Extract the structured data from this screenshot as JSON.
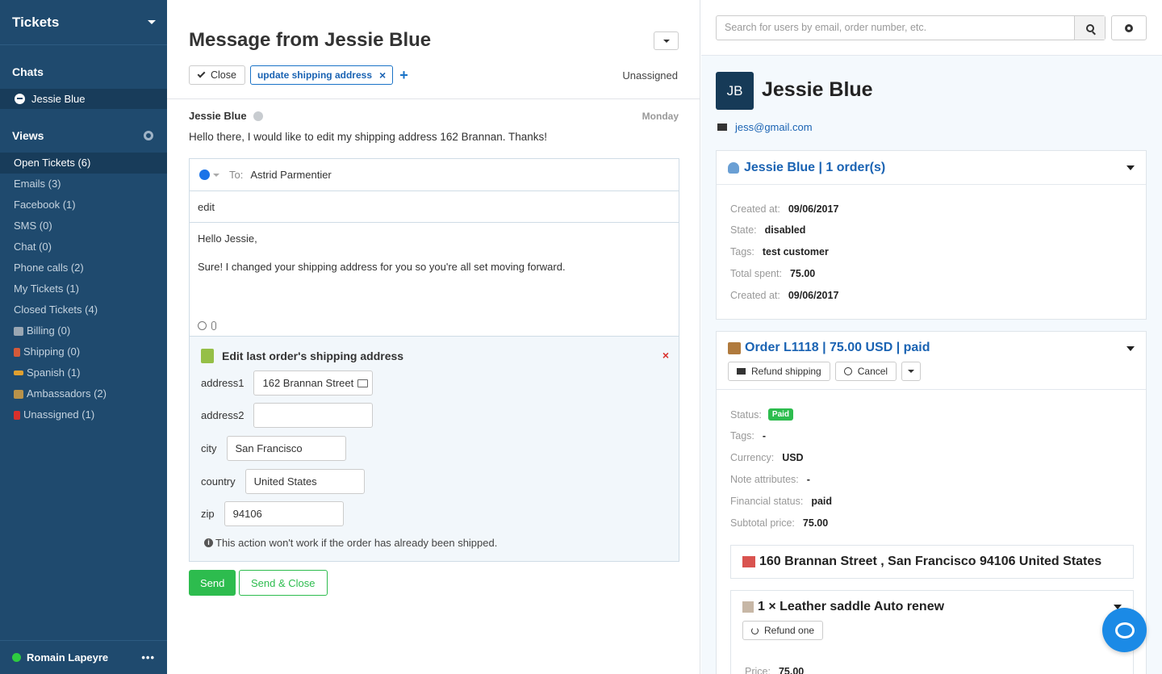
{
  "sidebar": {
    "title": "Tickets",
    "chats_label": "Chats",
    "chat_item": "Jessie Blue",
    "views_label": "Views",
    "items": [
      {
        "label": "Open Tickets (6)",
        "active": true,
        "icon": ""
      },
      {
        "label": "Emails (3)",
        "icon": ""
      },
      {
        "label": "Facebook (1)",
        "icon": ""
      },
      {
        "label": "SMS (0)",
        "icon": ""
      },
      {
        "label": "Chat (0)",
        "icon": ""
      },
      {
        "label": "Phone calls (2)",
        "icon": ""
      },
      {
        "label": "My Tickets (1)",
        "icon": ""
      },
      {
        "label": "Closed Tickets (4)",
        "icon": ""
      },
      {
        "label": "Billing (0)",
        "icon": "tag-icon"
      },
      {
        "label": "Shipping (0)",
        "icon": "rocket-icon"
      },
      {
        "label": "Spanish (1)",
        "icon": "flag-icon"
      },
      {
        "label": "Ambassadors (2)",
        "icon": "people-icon"
      },
      {
        "label": "Unassigned (1)",
        "icon": "red-flag-icon"
      }
    ],
    "user": "Romain Lapeyre",
    "more": "•••"
  },
  "ticket": {
    "title": "Message from Jessie Blue",
    "close_label": "Close",
    "tag": "update shipping address",
    "tag_remove": "×",
    "add_tag": "+",
    "assignee": "Unassigned",
    "message": {
      "author": "Jessie Blue",
      "date": "Monday",
      "body": "Hello there, I would like to edit my shipping address 162 Brannan. Thanks!"
    },
    "composer": {
      "to_label": "To:",
      "to": "Astrid Parmentier",
      "subject": "edit",
      "line1": "Hello Jessie,",
      "line2": "Sure! I changed your shipping address for you so you're all set moving forward."
    },
    "form": {
      "title": "Edit last order's shipping address",
      "close": "×",
      "fields": {
        "address1_label": "address1",
        "address1": "162 Brannan Street",
        "address2_label": "address2",
        "address2": "",
        "city_label": "city",
        "city": "San Francisco",
        "country_label": "country",
        "country": "United States",
        "zip_label": "zip",
        "zip": "94106"
      },
      "note": "This action won't work if the order has already been shipped."
    },
    "send": "Send",
    "send_close": "Send & Close"
  },
  "customer": {
    "search_placeholder": "Search for users by email, order number, etc.",
    "initials": "JB",
    "name": "Jessie Blue",
    "email": "jess@gmail.com",
    "summary_title": "Jessie Blue | 1 order(s)",
    "created_label": "Created at:",
    "created": "09/06/2017",
    "state_label": "State:",
    "state": "disabled",
    "tags_label": "Tags:",
    "tags": "test customer",
    "spent_label": "Total spent:",
    "spent": "75.00",
    "created2_label": "Created at:",
    "created2": "09/06/2017",
    "order": {
      "title": "Order L1118 | 75.00 USD | paid",
      "refund_shipping": "Refund shipping",
      "cancel": "Cancel",
      "status_label": "Status:",
      "status": "Paid",
      "tags_label": "Tags:",
      "tags": "-",
      "currency_label": "Currency:",
      "currency": "USD",
      "note_label": "Note attributes:",
      "note": "-",
      "financial_label": "Financial status:",
      "financial": "paid",
      "subtotal_label": "Subtotal price:",
      "subtotal": "75.00",
      "address": "160 Brannan Street , San Francisco 94106 United States",
      "item": "1 × Leather saddle Auto renew",
      "refund_one": "Refund one",
      "price_label": "Price:",
      "price": "75.00"
    }
  },
  "colors": {
    "sidebar": "#1f4a6e",
    "accent": "#1a63b3",
    "success": "#2dbc4e"
  }
}
